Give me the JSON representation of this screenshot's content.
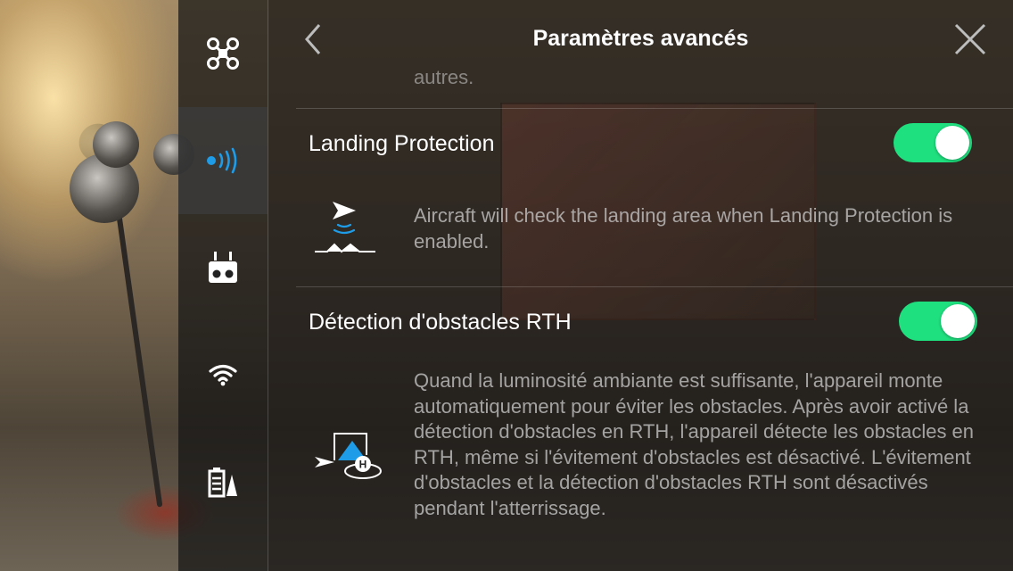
{
  "header": {
    "title": "Paramètres avancés"
  },
  "sidebar": {
    "items": [
      {
        "name": "aircraft",
        "icon": "drone-icon",
        "active": false
      },
      {
        "name": "sensors",
        "icon": "signal-icon",
        "active": true
      },
      {
        "name": "remote-controller",
        "icon": "remote-controller-icon",
        "active": false
      },
      {
        "name": "wifi",
        "icon": "wifi-icon",
        "active": false
      },
      {
        "name": "battery",
        "icon": "battery-icon",
        "active": false
      }
    ]
  },
  "content": {
    "previous_tail": "autres.",
    "settings": [
      {
        "label": "Landing Protection",
        "enabled": true,
        "icon": "landing-protection-icon",
        "description": "Aircraft will check the landing area when Landing Protection is enabled."
      },
      {
        "label": "Détection d'obstacles RTH",
        "enabled": true,
        "icon": "rth-obstacle-icon",
        "description": "Quand la luminosité ambiante est suffisante, l'appareil monte automatiquement pour éviter les obstacles. Après avoir activé la détection d'obstacles en RTH, l'appareil détecte les obstacles en RTH, même si l'évitement d'obstacles est désactivé. L'évitement d'obstacles et la détection d'obstacles RTH sont désactivés pendant l'atterrissage."
      }
    ]
  },
  "colors": {
    "toggle_on": "#1fe07f",
    "active_icon": "#1e9ce8"
  }
}
